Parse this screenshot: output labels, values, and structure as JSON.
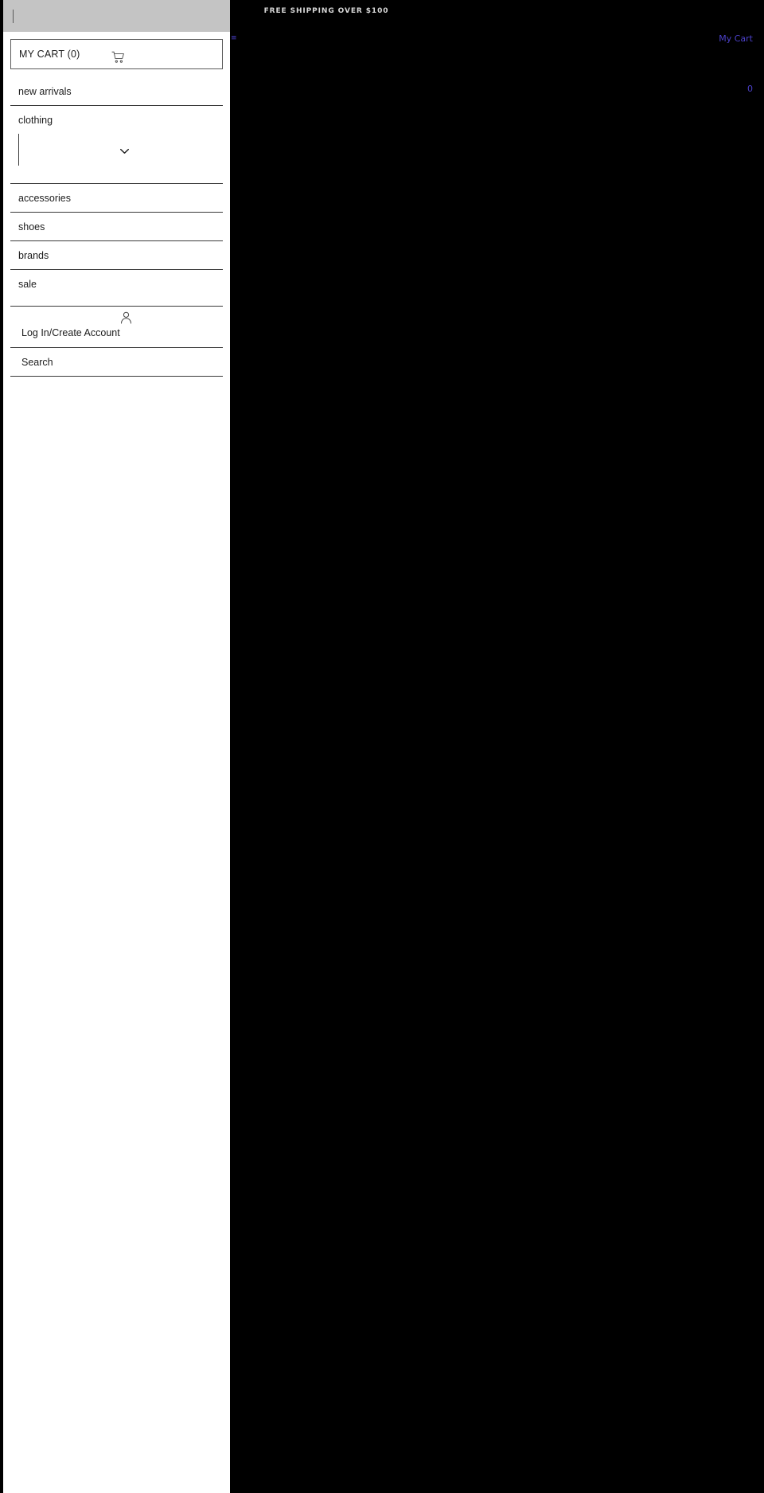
{
  "promo": {
    "text": "FREE SHIPPING OVER $100"
  },
  "utility": {
    "cart_link_label": "My Cart",
    "cart_count": "0",
    "menu_toggle_label": "≡"
  },
  "drawer": {
    "header": {
      "caret": ""
    },
    "cart": {
      "label": "MY CART (0)",
      "icon": "shopping-cart-icon"
    },
    "nav_items": [
      {
        "label": "new arrivals",
        "expandable": false
      },
      {
        "label": "clothing",
        "expandable": true,
        "chevron_icon": "chevron-down-icon"
      },
      {
        "label": "accessories",
        "expandable": false
      },
      {
        "label": "shoes",
        "expandable": false
      },
      {
        "label": "brands",
        "expandable": false
      },
      {
        "label": "sale",
        "expandable": false
      }
    ],
    "account": {
      "label": "Log In/Create Account",
      "icon": "person-icon"
    },
    "search": {
      "label": "Search"
    }
  },
  "colors": {
    "panel_bg": "#ffffff",
    "header_bg": "#c4c4c4",
    "page_bg": "#000000",
    "link": "#4b40c8",
    "rule": "#3a3a3a",
    "promo_text": "#d8d8d8"
  }
}
